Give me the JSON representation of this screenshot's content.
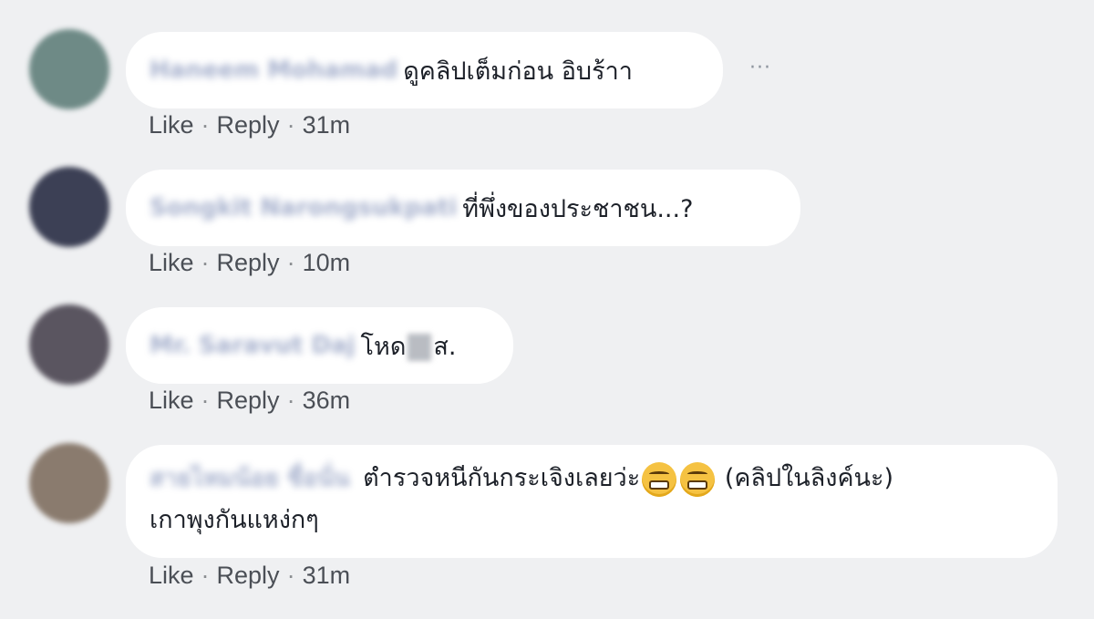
{
  "actions": {
    "like": "Like",
    "reply": "Reply",
    "separator": "·"
  },
  "more_label": "···",
  "comments": [
    {
      "author": "Haneem Mohamad",
      "text": "ดูคลิปเต็มก่อน อิบร้าา",
      "time": "31m",
      "avatar_color": "#6e8a86"
    },
    {
      "author": "Songkit Narongsukpati",
      "text": "ที่พึ่งของประชาชน...?",
      "time": "10m",
      "avatar_color": "#3c4055"
    },
    {
      "author": "Mr. Saravut Daj",
      "text_before": "โหด",
      "text_after": "ส.",
      "time": "36m",
      "avatar_color": "#5a5560"
    },
    {
      "author": "สายไหมน้อย ชื่อนั่น",
      "text_part1": "ตำรวจหนีกันกระเจิงเลยว่ะ",
      "text_part2": "(คลิปในลิงค์นะ)",
      "text_line2": "เกาพุงกันแหง่กๆ",
      "emojis": [
        "grimacing-face-icon",
        "grimacing-face-icon"
      ],
      "time": "31m",
      "avatar_color": "#8a7b6e"
    }
  ]
}
